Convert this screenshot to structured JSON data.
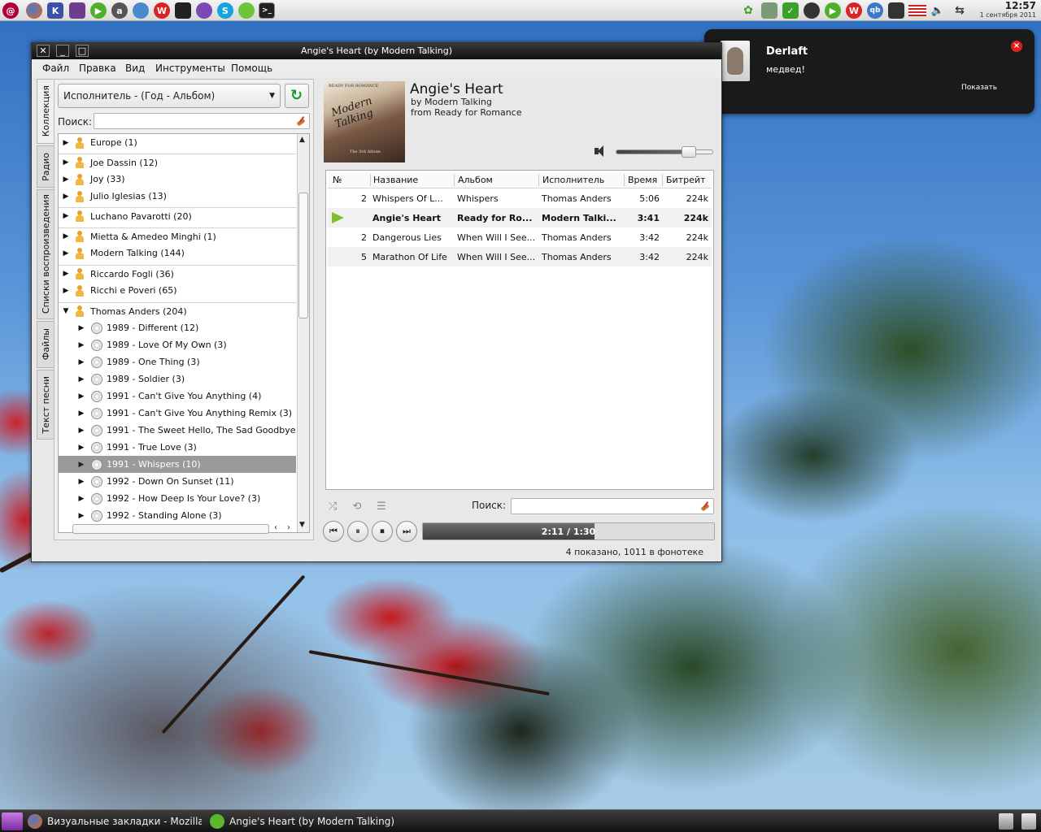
{
  "top_panel": {
    "icons": [
      "debian-swirl-icon",
      "firefox-icon",
      "kde-app-icon",
      "monitor-icon",
      "amarok-icon",
      "aim-icon",
      "pidgin-icon",
      "wps-icon",
      "steam-icon",
      "ghost-icon",
      "skype-icon",
      "audacious-icon",
      "terminal-icon"
    ],
    "tray_icons": [
      "flower-icon",
      "network-icon",
      "check-icon",
      "steam-icon",
      "play-icon",
      "wps-icon",
      "qb-icon",
      "cpu-icon",
      "us-flag-icon",
      "volume-icon",
      "usb-icon"
    ],
    "time": "12:57",
    "date": "1 сентября 2011"
  },
  "notification": {
    "title": "Derlaft",
    "body": "медвед!",
    "action": "Показать"
  },
  "window": {
    "title": "Angie's Heart (by Modern Talking)",
    "menu": [
      "Файл",
      "Правка",
      "Вид",
      "Инструменты",
      "Помощь"
    ],
    "side_tabs": [
      "Коллекция",
      "Радио",
      "Списки воспроизведения",
      "Файлы",
      "Текст песни"
    ]
  },
  "collection": {
    "grouping": "Исполнитель - (Год - Альбом)",
    "search_label": "Поиск:",
    "search_value": "",
    "artists": [
      {
        "label": "Europe (1)"
      },
      {
        "label": "Joe Dassin (12)"
      },
      {
        "label": "Joy (33)"
      },
      {
        "label": "Julio Iglesias (13)"
      },
      {
        "label": "Luchano Pavarotti (20)"
      },
      {
        "label": "Mietta & Amedeo Minghi (1)"
      },
      {
        "label": "Modern Talking (144)"
      },
      {
        "label": "Riccardo Fogli (36)"
      },
      {
        "label": "Ricchi e Poveri (65)"
      },
      {
        "label": "Thomas Anders (204)"
      }
    ],
    "albums": [
      {
        "label": "1989 - Different (12)"
      },
      {
        "label": "1989 - Love Of My Own (3)"
      },
      {
        "label": "1989 - One Thing (3)"
      },
      {
        "label": "1989 - Soldier (3)"
      },
      {
        "label": "1991 - Can't Give You Anything (4)"
      },
      {
        "label": "1991 - Can't Give You Anything Remix (3)"
      },
      {
        "label": "1991 - The Sweet Hello, The Sad Goodbye"
      },
      {
        "label": "1991 - True Love (3)"
      },
      {
        "label": "1991 - Whispers (10)"
      },
      {
        "label": "1992 - Down On Sunset (11)"
      },
      {
        "label": "1992 - How Deep Is Your Love? (3)"
      },
      {
        "label": "1992 - Standing Alone (3)"
      }
    ]
  },
  "now_playing": {
    "title": "Angie's Heart",
    "by": "by Modern Talking",
    "from": "from Ready for Romance",
    "cover_text_top": "READY FOR ROMANCE",
    "cover_text_script": "Modern Talking",
    "cover_text_bottom": "The 3rd Album",
    "volume_fraction": 0.75
  },
  "playlist": {
    "columns": [
      "№",
      "Название",
      "Альбом",
      "Исполнитель",
      "Время",
      "Битрейт"
    ],
    "rows": [
      {
        "num": "2",
        "title": "Whispers Of L...",
        "album": "Whispers",
        "artist": "Thomas Anders",
        "time": "5:06",
        "bitrate": "224k"
      },
      {
        "num": "",
        "title": "Angie's Heart",
        "album": "Ready for Ro...",
        "artist": "Modern Talki...",
        "time": "3:41",
        "bitrate": "224k"
      },
      {
        "num": "2",
        "title": "Dangerous Lies",
        "album": "When Will I See...",
        "artist": "Thomas Anders",
        "time": "3:42",
        "bitrate": "224k"
      },
      {
        "num": "5",
        "title": "Marathon Of Life",
        "album": "When Will I See...",
        "artist": "Thomas Anders",
        "time": "3:42",
        "bitrate": "224k"
      }
    ],
    "search_label": "Поиск:",
    "search_value": "",
    "position_text": "2:11 / 1:30",
    "progress_fraction": 0.59,
    "status": "4 показано, 1011 в фонотеке"
  },
  "taskbar": {
    "tasks": [
      "Визуальные закладки - Mozilla Firefox",
      "Angie's Heart (by Modern Talking)"
    ]
  }
}
